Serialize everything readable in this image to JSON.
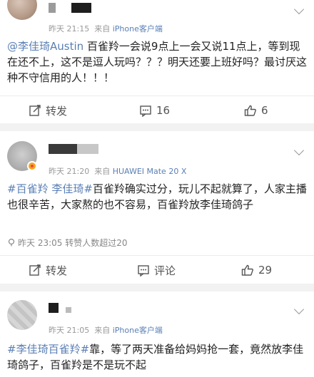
{
  "post1": {
    "time": "昨天 21:15",
    "source_prefix": "来自",
    "source": "iPhone客户端",
    "mention": "@李佳琦Austin",
    "text": " 百雀羚一会说9点上一会又说11点上，等到现在还不上，这不是逗人玩吗？？？明天还要上班好吗？最讨厌这种不守信用的人！！！",
    "repost_label": "转发",
    "comment_count": "16",
    "like_count": "6"
  },
  "post2": {
    "time": "昨天 21:20",
    "source_prefix": "来自",
    "source": "HUAWEI Mate 20 X",
    "topic": "#百雀羚 李佳琦#",
    "text": "百雀羚确实过分，玩儿不起就算了，人家主播也很辛苦，大家熬的也不容易，百雀羚放李佳琦鸽子",
    "hint_icon": "location-pin-icon",
    "hint": "昨天 23:05 转赞人数超过20",
    "repost_label": "转发",
    "comment_label": "评论",
    "like_count": "29"
  },
  "post3": {
    "time": "昨天 21:05",
    "source_prefix": "来自",
    "source": "iPhone客户端",
    "topic": "#李佳琦百雀羚#",
    "text": "靠，等了两天准备给妈妈抢一套，竟然放李佳琦鸽子，百雀羚是不是玩不起"
  },
  "colors": {
    "link": "#5a7fb5",
    "meta": "#999999",
    "background": "#f2f2f2"
  }
}
